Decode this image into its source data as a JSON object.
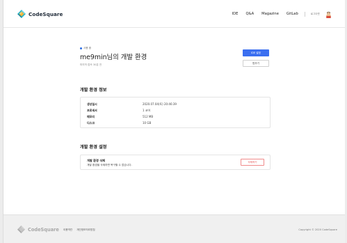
{
  "header": {
    "brand": "CodeSquare",
    "nav": [
      "IDE",
      "Q&A",
      "Magazine",
      "GitLab"
    ],
    "login_label": "로그아웃"
  },
  "environment": {
    "status": "사용 중",
    "title": "me9min님의 개발 환경",
    "subtitle": "마지막 접속 30분 전",
    "ide_button": "IDE 설정",
    "stop_button": "멈추기"
  },
  "info_section": {
    "title": "개발 환경 정보",
    "rows": [
      {
        "label": "생성일시",
        "value": "2020.07.04(토) 20:46:39"
      },
      {
        "label": "프로세서",
        "value": "1 코어"
      },
      {
        "label": "메모리",
        "value": "512 MB"
      },
      {
        "label": "디스크",
        "value": "10 GB"
      }
    ]
  },
  "settings_section": {
    "title": "개발 환경 설정",
    "delete_title": "개발 환경 삭제",
    "delete_desc": "개발 환경을 삭제하면 복구할 수 없습니다.",
    "delete_button": "삭제하기"
  },
  "footer": {
    "brand": "CodeSquare",
    "links": [
      "이용약관",
      "개인정보처리방침"
    ],
    "copyright": "Copyright © 2020 CodeSquare"
  },
  "colors": {
    "accent": "#3b6ff0",
    "danger": "#e65555",
    "status_dot": "#2f6fe4"
  },
  "icons": {
    "logo": "codesquare-logo-icon",
    "avatar": "user-avatar-icon"
  }
}
